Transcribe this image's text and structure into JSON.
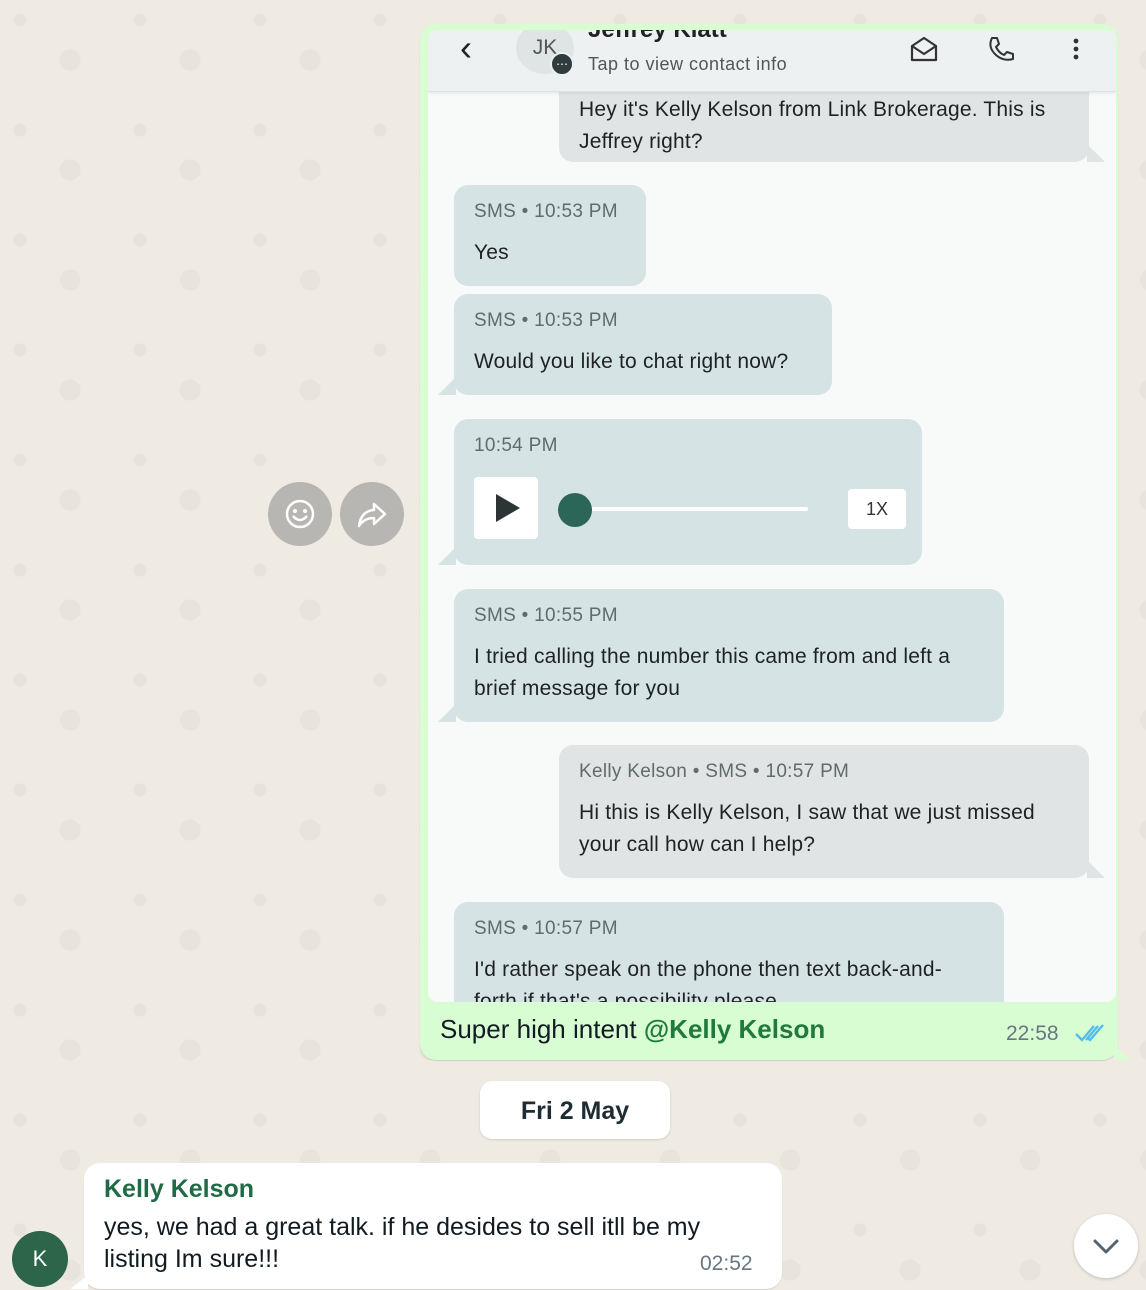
{
  "screenshot": {
    "header": {
      "back_icon": "chevron-left-icon",
      "avatar_initials": "JK",
      "contact_name": "Jeffrey Klatt",
      "subtitle": "Tap to view contact info",
      "icons": [
        "mail-icon",
        "phone-icon",
        "more-vert-icon"
      ]
    },
    "messages": [
      {
        "type": "outgoing",
        "meta": "",
        "text": "Hey it's Kelly Kelson from Link Brokerage. This is Jeffrey right?"
      },
      {
        "type": "incoming",
        "meta": "SMS • 10:53 PM",
        "text": "Yes"
      },
      {
        "type": "incoming",
        "meta": "SMS • 10:53 PM",
        "text": "Would you like to chat right now?"
      },
      {
        "type": "voice",
        "meta": "10:54 PM",
        "speed": "1X",
        "progress": 0
      },
      {
        "type": "incoming",
        "meta": "SMS • 10:55 PM",
        "text": "I tried calling the number this came from and left a brief message for you"
      },
      {
        "type": "outgoing",
        "meta": "Kelly Kelson • SMS • 10:57 PM",
        "text": "Hi this is Kelly Kelson, I saw that we just missed your call how can I help?"
      },
      {
        "type": "incoming",
        "meta": "SMS • 10:57 PM",
        "text": "I'd rather speak on the phone then text back-and-forth if that's a possibility please"
      }
    ]
  },
  "outgoing_message": {
    "caption_prefix": "Super high intent ",
    "mention": "@Kelly Kelson",
    "time": "22:58",
    "status": "read"
  },
  "date_separator": "Fri 2 May",
  "incoming_message": {
    "sender": "Kelly Kelson",
    "avatar_initial": "K",
    "text": "yes, we had a great talk. if he desides to sell itll be my listing Im sure!!!",
    "time": "02:52"
  },
  "colors": {
    "outgoing_bubble": "#d9fdd3",
    "sender_name": "#1f6b45",
    "read_ticks": "#53bdeb"
  }
}
